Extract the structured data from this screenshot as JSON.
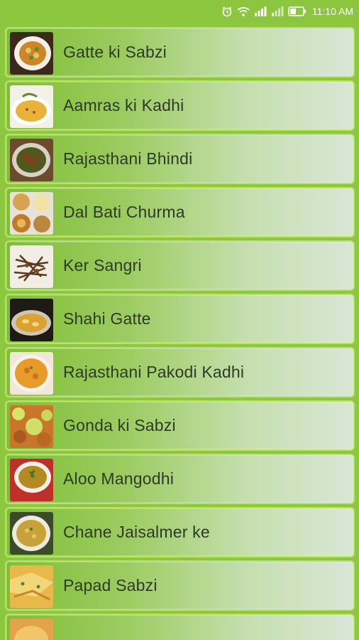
{
  "status_bar": {
    "time": "11:10 AM",
    "icons": [
      "alarm-icon",
      "wifi-icon",
      "signal-icon",
      "signal-2-icon",
      "battery-icon"
    ]
  },
  "recipes": [
    {
      "name": "Gatte ki Sabzi",
      "thumb": "gatte-sabzi-photo"
    },
    {
      "name": "Aamras ki Kadhi",
      "thumb": "aamras-kadhi-photo"
    },
    {
      "name": "Rajasthani Bhindi",
      "thumb": "bhindi-photo"
    },
    {
      "name": "Dal Bati Churma",
      "thumb": "dal-bati-photo"
    },
    {
      "name": "Ker Sangri",
      "thumb": "ker-sangri-photo"
    },
    {
      "name": "Shahi Gatte",
      "thumb": "shahi-gatte-photo"
    },
    {
      "name": "Rajasthani Pakodi Kadhi",
      "thumb": "pakodi-kadhi-photo"
    },
    {
      "name": "Gonda ki Sabzi",
      "thumb": "gonda-sabzi-photo"
    },
    {
      "name": "Aloo Mangodhi",
      "thumb": "aloo-mangodhi-photo"
    },
    {
      "name": "Chane Jaisalmer ke",
      "thumb": "chane-jaisalmer-photo"
    },
    {
      "name": "Papad Sabzi",
      "thumb": "papad-sabzi-photo"
    },
    {
      "name": "",
      "thumb": "partial-item-photo"
    }
  ]
}
